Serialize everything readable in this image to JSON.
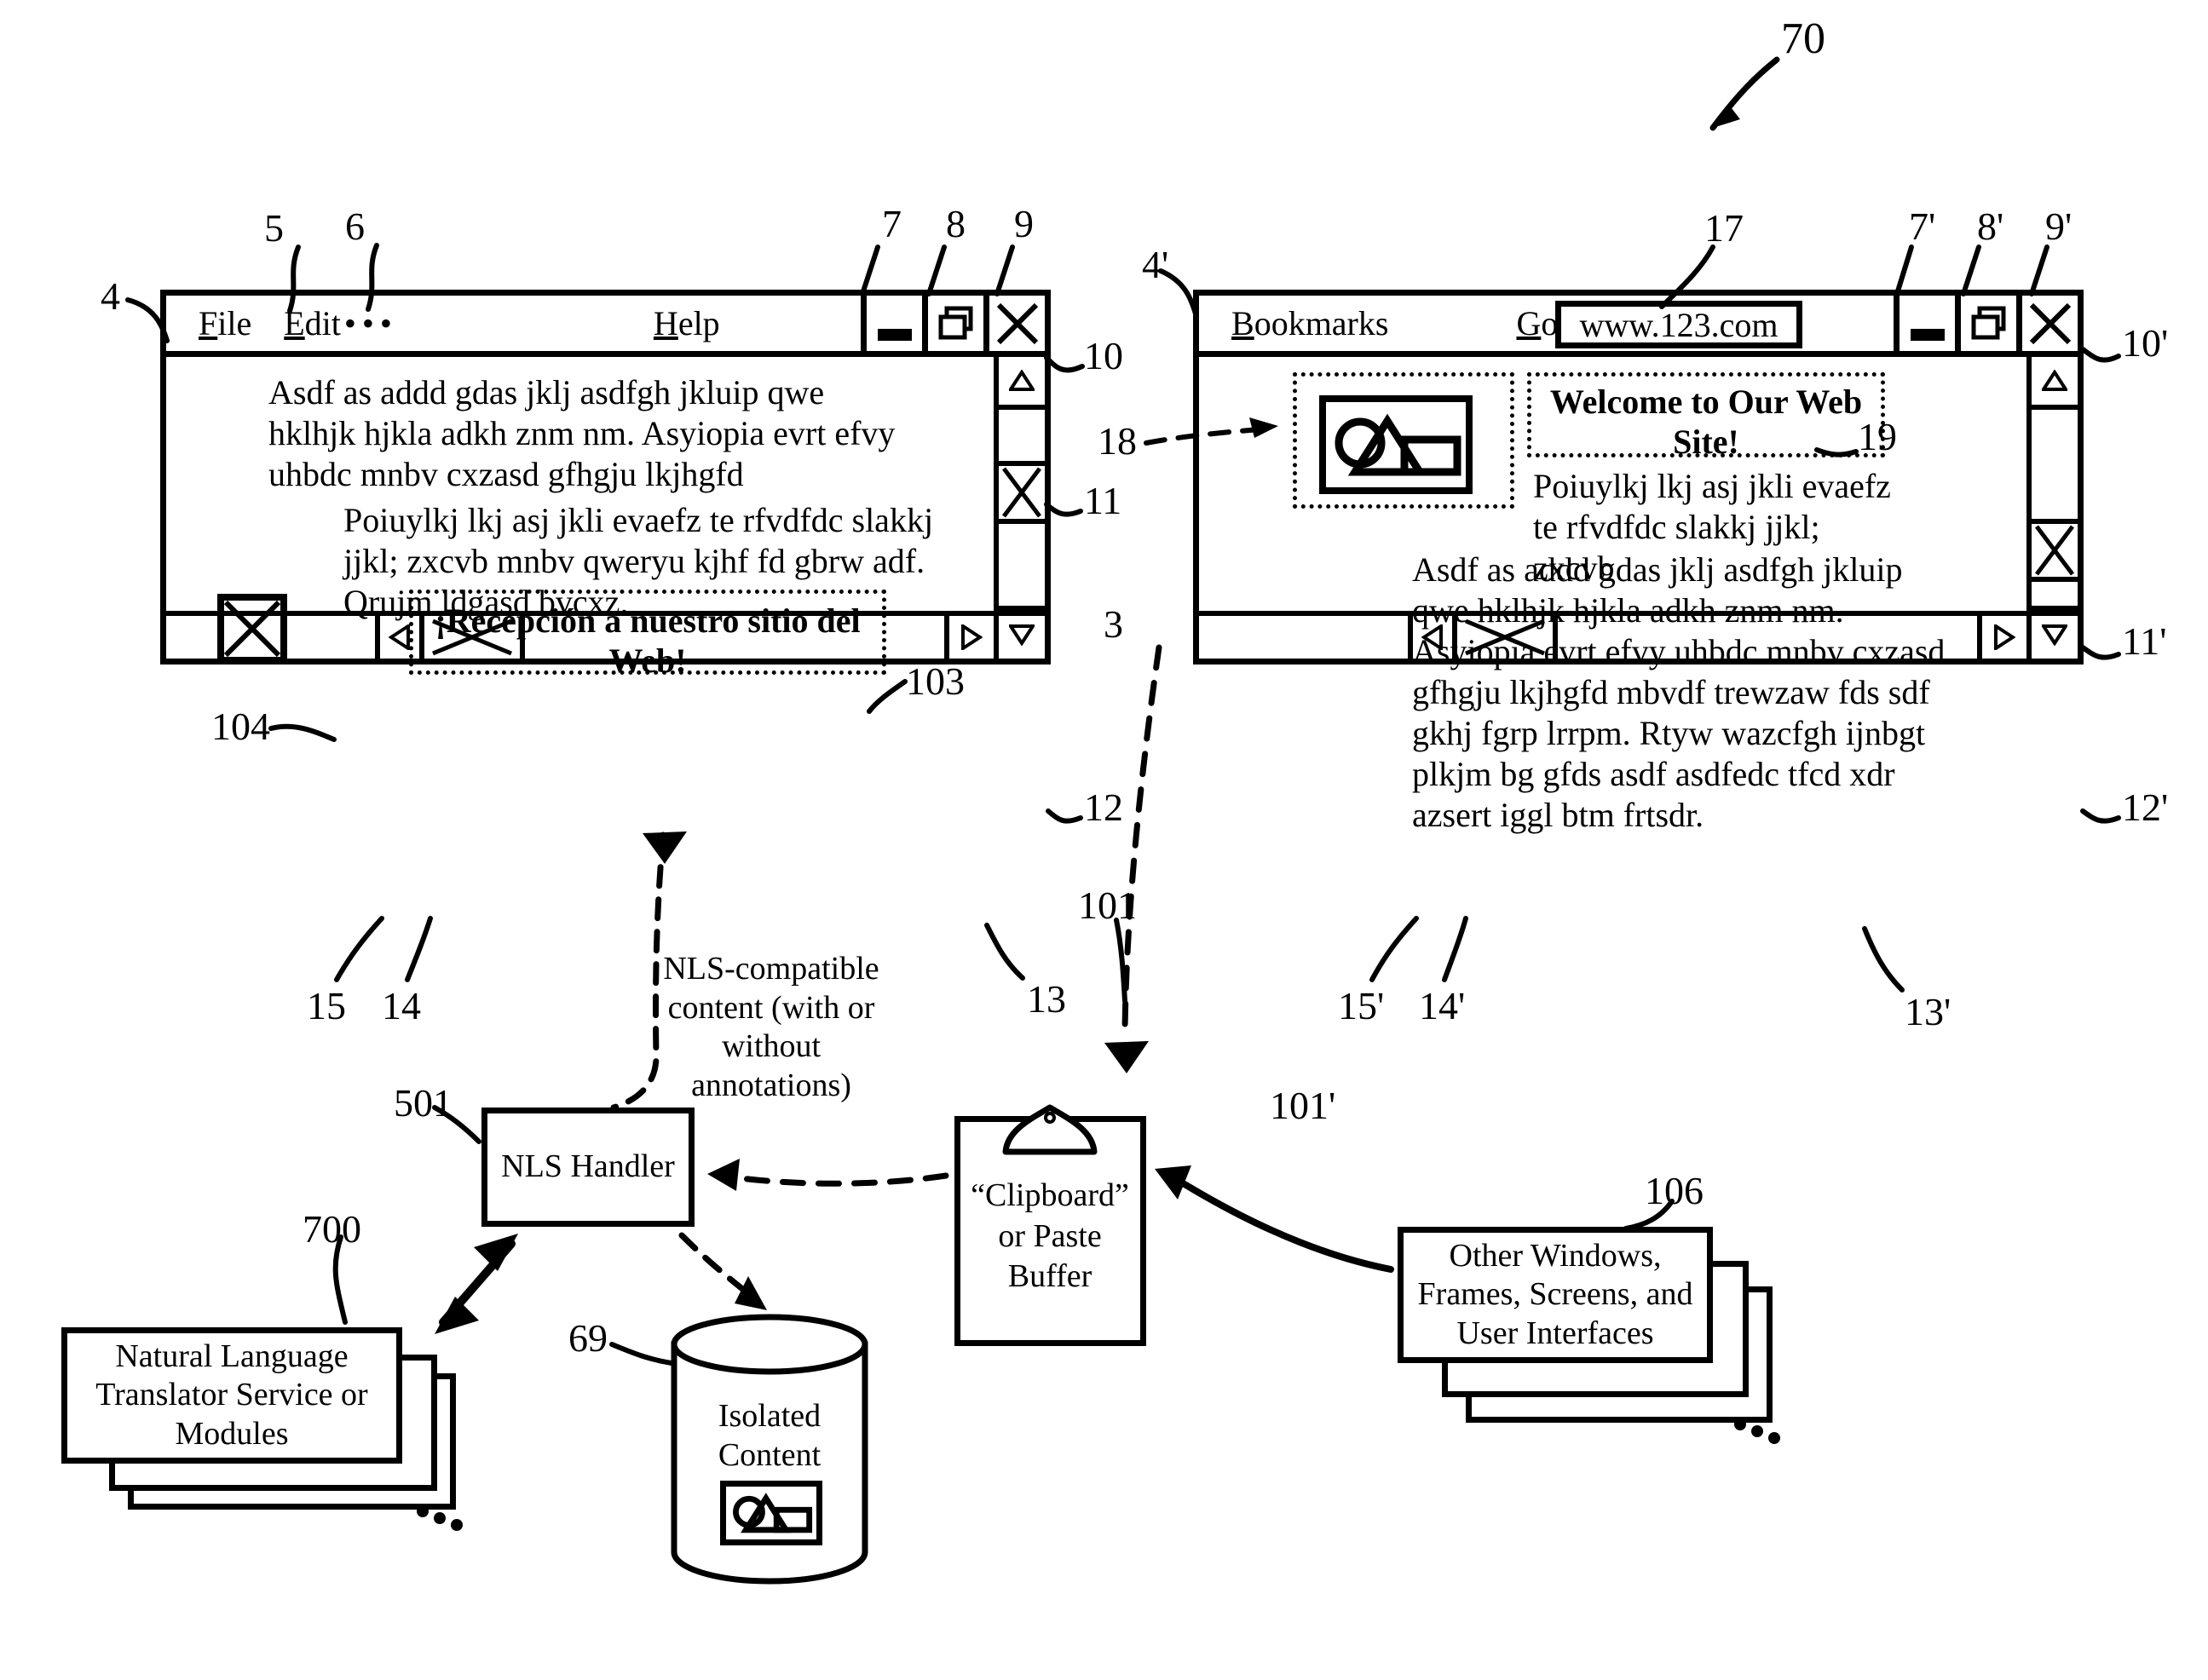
{
  "figure": {
    "label": "70"
  },
  "left_window": {
    "ref": "4",
    "menu": {
      "file": "File",
      "edit": "Edit",
      "dots": "...",
      "help": "Help"
    },
    "refs": {
      "file": "5",
      "edit": "6",
      "minimize": "7",
      "restore": "8",
      "close": "9",
      "scroll_up": "10",
      "scroll_thumb": "11",
      "scroll_down": "12",
      "scroll_right": "13",
      "hscroll_thumb": "14",
      "scroll_left": "15"
    },
    "body_paragraph_1": "Asdf as addd gdas jklj asdfgh jkluip qwe hklhjk hjkla adkh znm nm.  Asyiopia evrt efvy uhbdc mnbv cxzasd gfhgju lkjhgfd",
    "body_paragraph_2": "Poiuylkj lkj asj jkli evaefz te rfvdfdc slakkj jjkl; zxcvb mnbv qweryu kjhf fd gbrw adf.  Qrujm ldgasd bvcxz.",
    "annotation": {
      "ref_box": "103",
      "ref_image": "104",
      "text": "¡Recepción a nuestro sitio del Web!"
    }
  },
  "right_window": {
    "ref": "4'",
    "menu": {
      "bookmarks": "Bookmarks",
      "goto": "Goto"
    },
    "url_value": "www.123.com",
    "url_ref": "17",
    "refs": {
      "minimize": "7'",
      "restore": "8'",
      "close": "9'",
      "scroll_up": "10'",
      "scroll_thumb": "11'",
      "scroll_down": "12'",
      "scroll_right": "13'",
      "hscroll_thumb": "14'",
      "scroll_left": "15'",
      "image_block": "18",
      "welcome_block": "19"
    },
    "welcome_title": "Welcome to Our Web Site!",
    "body_paragraph_1": "Poiuylkj lkj asj jkli evaefz te rfvdfdc slakkj jjkl; zxcvb",
    "body_paragraph_2": "Asdf as addd gdas jklj asdfgh jkluip qwe hklhjk hjkla adkh znm nm.  Asyiopia evrt efvy uhbdc mnbv cxzasd gfhgju lkjhgfd mbvdf trewzaw fds sdf gkhj fgrp lrrpm. Rtyw wazcfgh ijnbgt plkjm bg gfds asdf asdfedc tfcd xdr azsert iggl btm frtsdr."
  },
  "flow": {
    "nls_note": "NLS-compatible content (with or without annotations)",
    "nls_handler": "NLS Handler",
    "nls_handler_ref": "501",
    "clipboard": "“Clipboard” or Paste Buffer",
    "clipboard_ref_left": "3",
    "clipboard_ref_mid": "101",
    "clipboard_ref_right": "101'",
    "translator": "Natural Language Translator Service or Modules",
    "translator_ref": "700",
    "isolated": "Isolated Content",
    "isolated_ref": "69",
    "other_windows": "Other Windows, Frames, Screens, and User Interfaces",
    "other_windows_ref": "106"
  }
}
